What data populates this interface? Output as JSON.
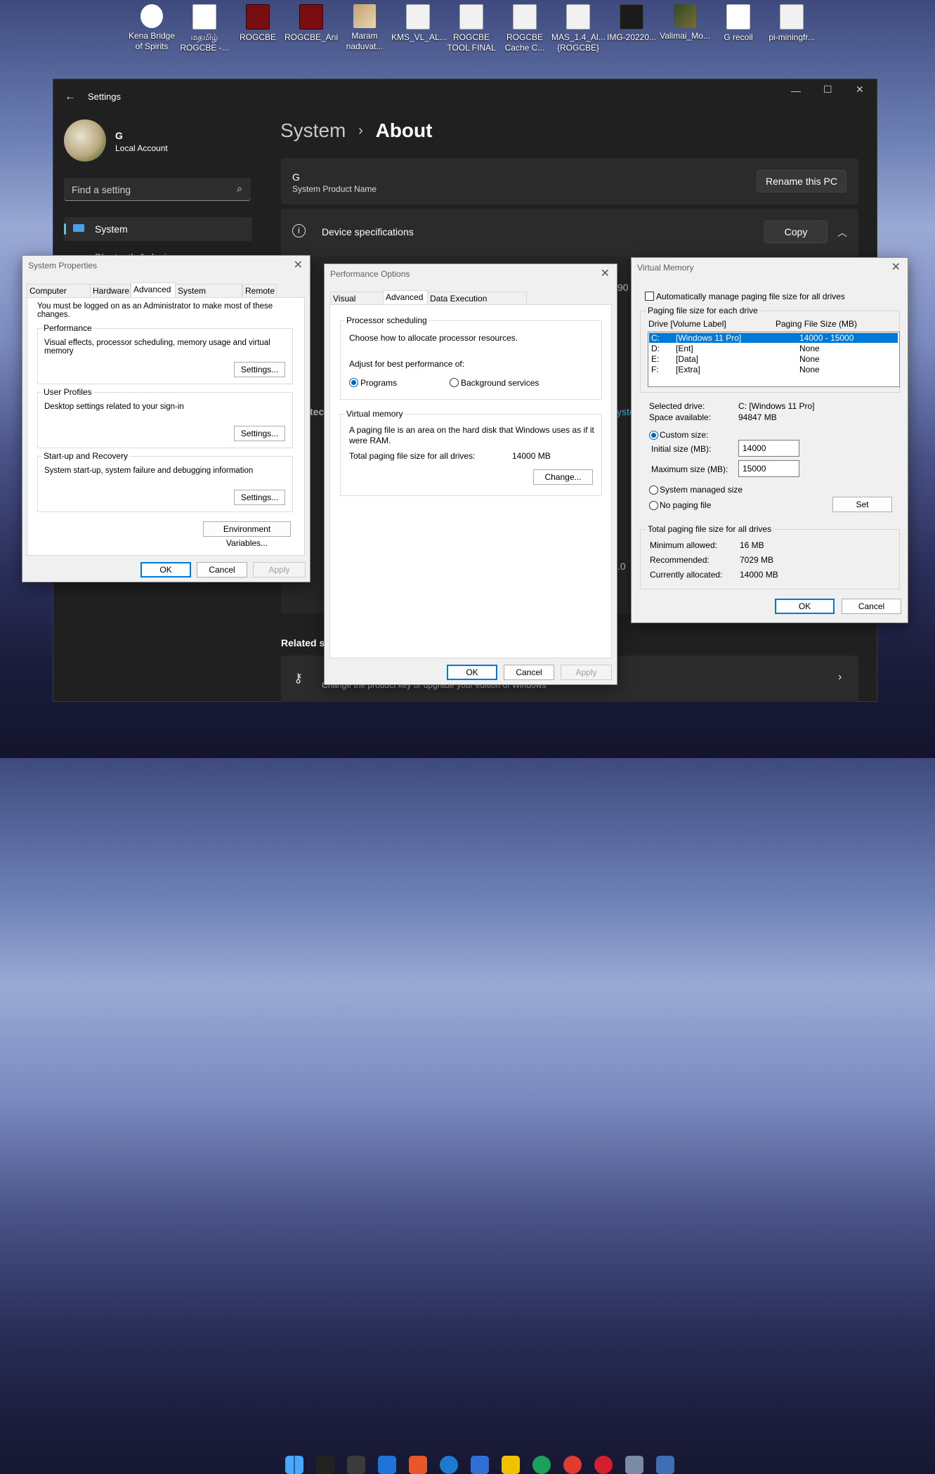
{
  "desktop": {
    "icons": [
      {
        "label": "Kena Bridge\nof Spirits",
        "kind": "kena"
      },
      {
        "label": "மதமிழ்\nROGCBE -...",
        "kind": "doc"
      },
      {
        "label": "ROGCBE",
        "kind": "red"
      },
      {
        "label": "ROGCBE_Ani",
        "kind": "red"
      },
      {
        "label": "Maram\nnaduvat...",
        "kind": "photo"
      },
      {
        "label": "KMS_VL_AL...",
        "kind": "gear"
      },
      {
        "label": "ROGCBE\nTOOL FINAL",
        "kind": "gear"
      },
      {
        "label": "ROGCBE\nCache C...",
        "kind": "gear"
      },
      {
        "label": "MAS_1.4_Al...\n{ROGCBE}",
        "kind": "gear"
      },
      {
        "label": "IMG-20220...",
        "kind": "dark"
      },
      {
        "label": "Valimai_Mo...",
        "kind": "green"
      },
      {
        "label": "G recoil",
        "kind": "doc"
      },
      {
        "label": "pi-miningfr...",
        "kind": "gear"
      }
    ]
  },
  "settings": {
    "app_title": "Settings",
    "user": {
      "name": "G",
      "account": "Local Account"
    },
    "search": {
      "placeholder": "Find a setting"
    },
    "nav": {
      "selected": "System",
      "partial": "Bluetooth & devices"
    },
    "breadcrumb": {
      "parent": "System",
      "sep": "›",
      "current": "About"
    },
    "pc": {
      "name": "G",
      "product": "System Product Name",
      "rename_label": "Rename this PC"
    },
    "device_specs": {
      "label": "Device specifications",
      "copy_label": "Copy"
    },
    "related": {
      "heading": "Related se",
      "product_key": "Change the product key or upgrade your edition of Windows"
    },
    "peek": {
      "a": "90",
      "b": "yste",
      "c": ".0",
      "d": "tec"
    }
  },
  "system_properties": {
    "title": "System Properties",
    "tabs": [
      "Computer Name",
      "Hardware",
      "Advanced",
      "System Protection",
      "Remote"
    ],
    "active_tab": "Advanced",
    "admin_note": "You must be logged on as an Administrator to make most of these changes.",
    "performance": {
      "legend": "Performance",
      "text": "Visual effects, processor scheduling, memory usage and virtual memory",
      "button": "Settings..."
    },
    "user_profiles": {
      "legend": "User Profiles",
      "text": "Desktop settings related to your sign-in",
      "button": "Settings..."
    },
    "startup": {
      "legend": "Start-up and Recovery",
      "text": "System start-up, system failure and debugging information",
      "button": "Settings..."
    },
    "env_button": "Environment Variables...",
    "ok": "OK",
    "cancel": "Cancel",
    "apply": "Apply"
  },
  "performance_options": {
    "title": "Performance Options",
    "tabs": [
      "Visual Effects",
      "Advanced",
      "Data Execution Prevention"
    ],
    "active_tab": "Advanced",
    "scheduling": {
      "legend": "Processor scheduling",
      "desc": "Choose how to allocate processor resources.",
      "adjust": "Adjust for best performance of:",
      "programs": "Programs",
      "background": "Background services",
      "selected": "Programs"
    },
    "virtual_memory": {
      "legend": "Virtual memory",
      "desc": "A paging file is an area on the hard disk that Windows uses as if it were RAM.",
      "total_label": "Total paging file size for all drives:",
      "total_value": "14000 MB",
      "change": "Change..."
    },
    "ok": "OK",
    "cancel": "Cancel",
    "apply": "Apply"
  },
  "virtual_memory": {
    "title": "Virtual Memory",
    "auto_manage": {
      "label": "Automatically manage paging file size for all drives",
      "checked": false
    },
    "group_label": "Paging file size for each drive",
    "col_drive": "Drive  [Volume Label]",
    "col_size": "Paging File Size (MB)",
    "drives": [
      {
        "drive": "C:",
        "label": "[Windows 11 Pro]",
        "size": "14000 - 15000",
        "selected": true
      },
      {
        "drive": "D:",
        "label": "[Ent]",
        "size": "None",
        "selected": false
      },
      {
        "drive": "E:",
        "label": "[Data]",
        "size": "None",
        "selected": false
      },
      {
        "drive": "F:",
        "label": "[Extra]",
        "size": "None",
        "selected": false
      }
    ],
    "selected_drive_label": "Selected drive:",
    "selected_drive_value": "C:  [Windows 11 Pro]",
    "space_label": "Space available:",
    "space_value": "94847 MB",
    "custom_size": "Custom size:",
    "initial_label": "Initial size (MB):",
    "initial_value": "14000",
    "max_label": "Maximum size (MB):",
    "max_value": "15000",
    "system_managed": "System managed size",
    "no_paging": "No paging file",
    "mode": "custom",
    "set": "Set",
    "totals": {
      "legend": "Total paging file size for all drives",
      "min_label": "Minimum allowed:",
      "min_value": "16 MB",
      "rec_label": "Recommended:",
      "rec_value": "7029 MB",
      "cur_label": "Currently allocated:",
      "cur_value": "14000 MB"
    },
    "ok": "OK",
    "cancel": "Cancel"
  },
  "taskbar": {
    "icons": [
      "start-icon",
      "search-icon",
      "calculator-icon",
      "mail-icon",
      "app-r-icon",
      "ccleaner-icon",
      "store-icon",
      "file-explorer-icon",
      "edge-icon",
      "chrome-icon",
      "opera-icon",
      "settings-gear-icon",
      "remote-desktop-icon"
    ]
  },
  "colors": {
    "accent": "#0078d7",
    "selection": "#0078d7",
    "settings_bg": "#202020",
    "card_bg": "#2b2b2b"
  }
}
